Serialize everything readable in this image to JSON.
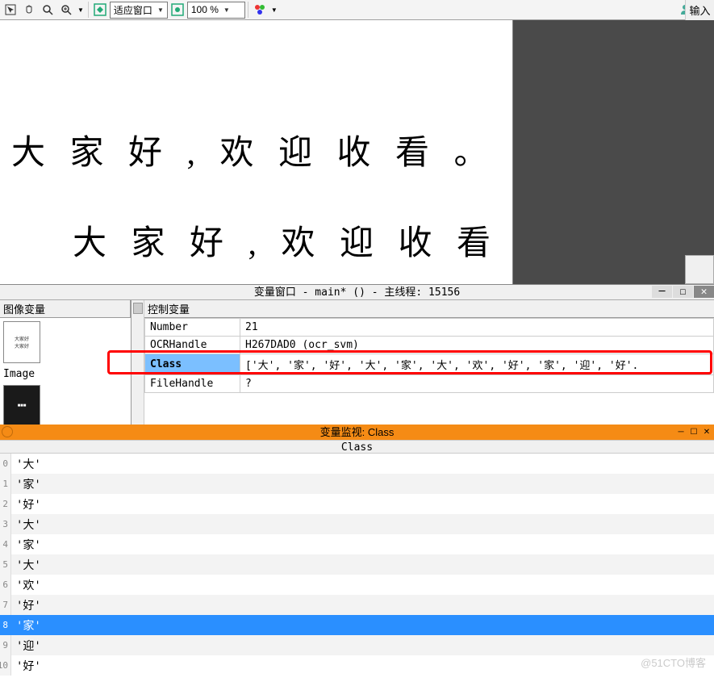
{
  "toolbar": {
    "fit_window_label": "适应窗口",
    "zoom_value": "100 %",
    "input_label": "输入"
  },
  "canvas": {
    "line1": "大 家 好 , 欢 迎 收 看 。",
    "line2": "大 家 好 , 欢 迎 收 看 。"
  },
  "var_window": {
    "title": "变量窗口 - main* () - 主线程: 15156",
    "left_label": "图像变量",
    "image_label": "Image",
    "right_label": "控制变量",
    "rows": [
      {
        "name": "Number",
        "value": "21"
      },
      {
        "name": "OCRHandle",
        "value": "H267DAD0 (ocr_svm)"
      },
      {
        "name": "Class",
        "value": "['大', '家', '好', '大', '家', '大', '欢', '好', '家', '迎', '好'."
      },
      {
        "name": "FileHandle",
        "value": "?"
      }
    ]
  },
  "monitor": {
    "title": "变量监视: Class",
    "header": "Class",
    "items": [
      {
        "idx": "0",
        "val": "'大'"
      },
      {
        "idx": "1",
        "val": "'家'"
      },
      {
        "idx": "2",
        "val": "'好'"
      },
      {
        "idx": "3",
        "val": "'大'"
      },
      {
        "idx": "4",
        "val": "'家'"
      },
      {
        "idx": "5",
        "val": "'大'"
      },
      {
        "idx": "6",
        "val": "'欢'"
      },
      {
        "idx": "7",
        "val": "'好'"
      },
      {
        "idx": "8",
        "val": "'家'"
      },
      {
        "idx": "9",
        "val": "'迎'"
      },
      {
        "idx": "10",
        "val": "'好'"
      }
    ],
    "selected_index": 8
  },
  "watermark": "@51CTO博客"
}
